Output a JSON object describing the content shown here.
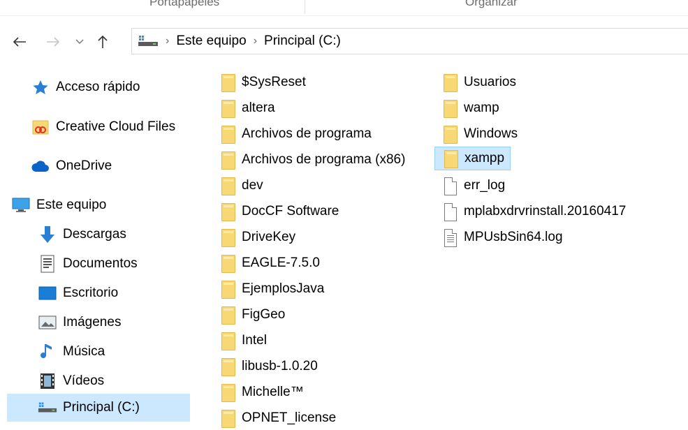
{
  "ribbon": {
    "groups": [
      "Portapapeles",
      "Organizar"
    ]
  },
  "nav": {
    "back_icon": "arrow-left-icon",
    "forward_icon": "arrow-right-icon",
    "recent_icon": "chevron-down-icon",
    "up_icon": "arrow-up-icon"
  },
  "address": {
    "crumbs": [
      "Este equipo",
      "Principal (C:)"
    ]
  },
  "sidebar": {
    "items": [
      {
        "label": "Acceso rápido",
        "icon": "star-icon"
      },
      {
        "label": "Creative Cloud Files",
        "icon": "creative-cloud-icon"
      },
      {
        "label": "OneDrive",
        "icon": "cloud-icon"
      },
      {
        "label": "Este equipo",
        "icon": "computer-icon"
      },
      {
        "label": "Descargas",
        "icon": "download-icon"
      },
      {
        "label": "Documentos",
        "icon": "documents-icon"
      },
      {
        "label": "Escritorio",
        "icon": "desktop-icon"
      },
      {
        "label": "Imágenes",
        "icon": "pictures-icon"
      },
      {
        "label": "Música",
        "icon": "music-icon"
      },
      {
        "label": "Vídeos",
        "icon": "videos-icon"
      },
      {
        "label": "Principal (C:)",
        "icon": "drive-icon"
      }
    ]
  },
  "files": {
    "col1": [
      "$SysReset",
      "altera",
      "Archivos de programa",
      "Archivos de programa (x86)",
      "dev",
      "DocCF Software",
      "DriveKey",
      "EAGLE-7.5.0",
      "EjemplosJava",
      "FigGeo",
      "Intel",
      "libusb-1.0.20",
      "Michelle™",
      "OPNET_license"
    ],
    "col2": [
      {
        "name": "Usuarios",
        "type": "folder"
      },
      {
        "name": "wamp",
        "type": "folder"
      },
      {
        "name": "Windows",
        "type": "folder"
      },
      {
        "name": "xampp",
        "type": "folder"
      },
      {
        "name": "err_log",
        "type": "file"
      },
      {
        "name": "mplabxdrvrinstall.20160417",
        "type": "file"
      },
      {
        "name": "MPUsbSin64.log",
        "type": "textfile"
      }
    ]
  },
  "colors": {
    "selection": "#cce8ff",
    "folder": "#f8d775"
  }
}
